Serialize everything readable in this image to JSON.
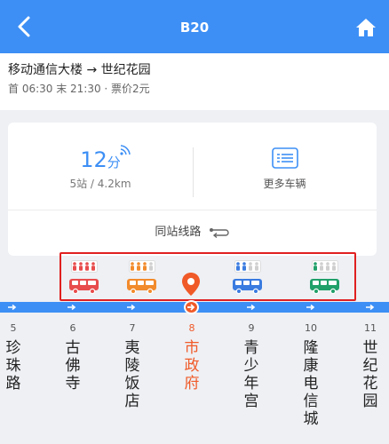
{
  "header": {
    "title": "B20",
    "back_icon": "back-arrow-icon",
    "home_icon": "home-icon"
  },
  "info": {
    "route": "移动通信大楼 → 世纪花园",
    "schedule": "首 06:30 末 21:30 · 票价2元"
  },
  "card": {
    "eta_value": "12",
    "eta_unit": "分",
    "distance": "5站 / 4.2km",
    "more_vehicles": "更多车辆",
    "same_station_lines": "同站线路"
  },
  "buses": [
    {
      "color": "#e84c4c",
      "crowd": "crowded"
    },
    {
      "color": "#f28b2c",
      "crowd": "busy"
    },
    {
      "color": "#3a7be0",
      "crowd": "moderate"
    },
    {
      "color": "#21a06a",
      "crowd": "empty"
    }
  ],
  "stops": [
    {
      "num": "5",
      "name": "珍珠路"
    },
    {
      "num": "6",
      "name": "古佛寺"
    },
    {
      "num": "7",
      "name": "夷陵饭店"
    },
    {
      "num": "8",
      "name": "市政府",
      "current": true
    },
    {
      "num": "9",
      "name": "青少年宫"
    },
    {
      "num": "10",
      "name": "隆康电信城"
    },
    {
      "num": "11",
      "name": "世纪花园"
    }
  ],
  "colors": {
    "accent": "#3d8ff5",
    "current": "#f05a28",
    "highlight_box": "#e02020"
  }
}
